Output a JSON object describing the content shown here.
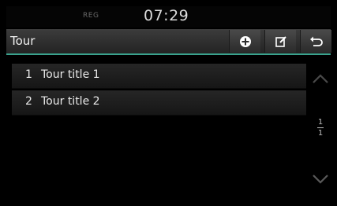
{
  "status": {
    "reg_label": "REG",
    "time": "07:29"
  },
  "header": {
    "title": "Tour"
  },
  "toolbar": {
    "add_icon": "plus-circle-icon",
    "edit_icon": "edit-icon",
    "back_icon": "back-arrow-icon"
  },
  "list": {
    "items": [
      {
        "number": "1",
        "title": "Tour title 1"
      },
      {
        "number": "2",
        "title": "Tour title 2"
      }
    ]
  },
  "pager": {
    "current": "1",
    "total": "1"
  },
  "colors": {
    "accent": "#3aa38e",
    "background": "#000000"
  }
}
